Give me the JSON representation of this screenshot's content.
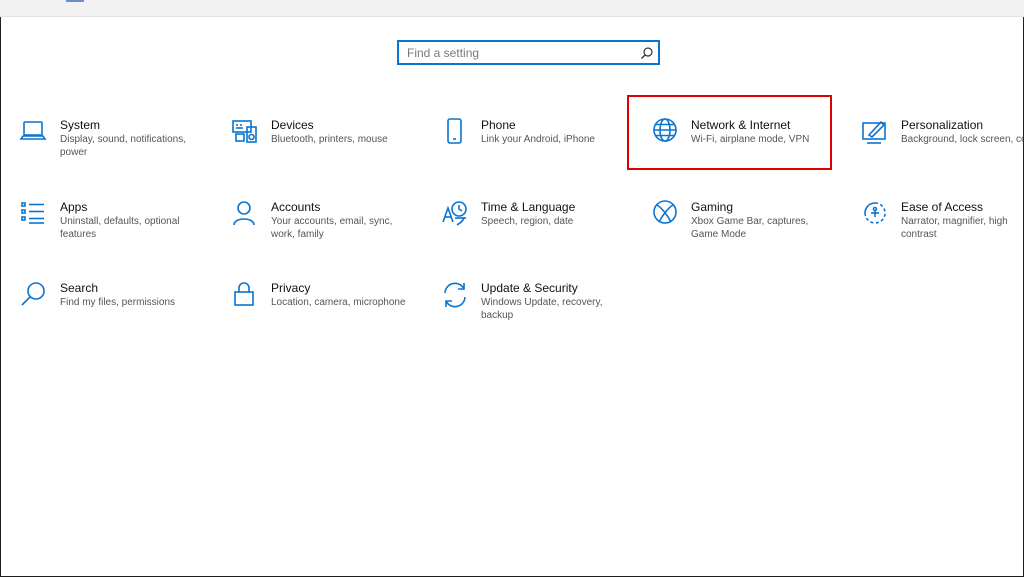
{
  "search": {
    "placeholder": "Find a setting"
  },
  "colors": {
    "accent": "#0a74d1",
    "highlight": "#e00000"
  },
  "tiles": [
    {
      "title": "System",
      "desc": "Display, sound, notifications, power",
      "icon": "laptop-icon"
    },
    {
      "title": "Devices",
      "desc": "Bluetooth, printers, mouse",
      "icon": "devices-icon"
    },
    {
      "title": "Phone",
      "desc": "Link your Android, iPhone",
      "icon": "phone-icon"
    },
    {
      "title": "Network & Internet",
      "desc": "Wi-Fi, airplane mode, VPN",
      "icon": "globe-icon"
    },
    {
      "title": "Personalization",
      "desc": "Background, lock screen, colors",
      "icon": "paint-icon"
    },
    {
      "title": "Apps",
      "desc": "Uninstall, defaults, optional features",
      "icon": "apps-list-icon"
    },
    {
      "title": "Accounts",
      "desc": "Your accounts, email, sync, work, family",
      "icon": "person-icon"
    },
    {
      "title": "Time & Language",
      "desc": "Speech, region, date",
      "icon": "time-language-icon"
    },
    {
      "title": "Gaming",
      "desc": "Xbox Game Bar, captures, Game Mode",
      "icon": "xbox-icon"
    },
    {
      "title": "Ease of Access",
      "desc": "Narrator, magnifier, high contrast",
      "icon": "ease-of-access-icon"
    },
    {
      "title": "Search",
      "desc": "Find my files, permissions",
      "icon": "magnifier-icon"
    },
    {
      "title": "Privacy",
      "desc": "Location, camera, microphone",
      "icon": "lock-icon"
    },
    {
      "title": "Update & Security",
      "desc": "Windows Update, recovery, backup",
      "icon": "sync-icon"
    }
  ]
}
